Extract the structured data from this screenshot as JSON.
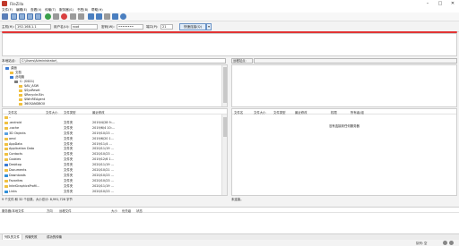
{
  "window": {
    "title": "FileZilla",
    "controls": [
      "–",
      "□",
      "✕"
    ]
  },
  "menu": [
    "文件(F)",
    "编辑(E)",
    "查看(V)",
    "传输(T)",
    "服务器(S)",
    "书签(B)",
    "帮助(H)"
  ],
  "toolbar": {
    "icons": [
      "site-manager-icon",
      "toggle-log-icon",
      "toggle-local-tree-icon",
      "toggle-remote-tree-icon",
      "toggle-queue-icon",
      "refresh-icon",
      "process-queue-icon",
      "cancel-icon",
      "disconnect-icon",
      "reconnect-icon",
      "filter-icon",
      "compare-icon",
      "sync-browse-icon",
      "search-icon",
      "binoculars-icon"
    ]
  },
  "quickconnect": {
    "host_label": "主机(H):",
    "host_value": "192.168.1.1",
    "user_label": "用户名(U):",
    "user_value": "root",
    "pass_label": "密码(W):",
    "pass_value": "••••••••",
    "port_label": "端口(P):",
    "port_value": "21",
    "connect_label": "快速连接(Q)",
    "dropdown_label": "▾"
  },
  "local": {
    "path_label": "本地站点:",
    "path_value": "C:\\Users\\Administrator\\",
    "tree": [
      {
        "label": "桌面",
        "level": 0,
        "color": "#3a7bd5"
      },
      {
        "label": "文档",
        "level": 1,
        "color": "#f0c040"
      },
      {
        "label": "此电脑",
        "level": 1,
        "color": "#3a7bd5"
      },
      {
        "label": "C: (SSD1)",
        "level": 2,
        "color": "#7a7a7a"
      },
      {
        "label": "$AV_ASW",
        "level": 3,
        "color": "#f0c040"
      },
      {
        "label": "$SysReset",
        "level": 3,
        "color": "#f0c040"
      },
      {
        "label": "$Recycle.Bin",
        "level": 3,
        "color": "#f0c040"
      },
      {
        "label": "$WinREAgent",
        "level": 3,
        "color": "#f0c040"
      },
      {
        "label": "360SANDBOX",
        "level": 3,
        "color": "#f0c040"
      }
    ],
    "headers": [
      "文件名",
      "文件大小",
      "文件类型",
      "最近修改"
    ],
    "files": [
      {
        "name": "..",
        "size": "",
        "type": "",
        "modified": "",
        "color": "#f0c040"
      },
      {
        "name": ".android",
        "size": "",
        "type": "文件夹",
        "modified": "2019/4/28 9:...",
        "color": "#f0c040"
      },
      {
        "name": ".cache",
        "size": "",
        "type": "文件夹",
        "modified": "2019/6/4 10:...",
        "color": "#f0c040"
      },
      {
        "name": "3D Objects",
        "size": "",
        "type": "文件夹",
        "modified": "2019/10/23 ...",
        "color": "#5aa0e0"
      },
      {
        "name": "amd",
        "size": "",
        "type": "文件夹",
        "modified": "2019/6/20 1...",
        "color": "#f0c040"
      },
      {
        "name": "AppData",
        "size": "",
        "type": "文件夹",
        "modified": "2019/11/4 ...",
        "color": "#f0c040"
      },
      {
        "name": "Application Data",
        "size": "",
        "type": "文件夹",
        "modified": "2020/11/19 ...",
        "color": "#f0c040"
      },
      {
        "name": "Contacts",
        "size": "",
        "type": "文件夹",
        "modified": "2020/10/23 ...",
        "color": "#f0c040"
      },
      {
        "name": "Cookies",
        "size": "",
        "type": "文件夹",
        "modified": "2019/12/6 1...",
        "color": "#f0c040"
      },
      {
        "name": "Desktop",
        "size": "",
        "type": "文件夹",
        "modified": "2020/11/19 ...",
        "color": "#3a7bd5"
      },
      {
        "name": "Documents",
        "size": "",
        "type": "文件夹",
        "modified": "2020/10/21 ...",
        "color": "#f0c040"
      },
      {
        "name": "Downloads",
        "size": "",
        "type": "文件夹",
        "modified": "2020/10/23 ...",
        "color": "#2f8fd8"
      },
      {
        "name": "Favorites",
        "size": "",
        "type": "文件夹",
        "modified": "2020/10/23 ...",
        "color": "#f0c040"
      },
      {
        "name": "IntelGraphicsProfil...",
        "size": "",
        "type": "文件夹",
        "modified": "2020/11/19 ...",
        "color": "#f0c040"
      },
      {
        "name": "Links",
        "size": "",
        "type": "文件夹",
        "modified": "2020/10/23 ...",
        "color": "#2f8fd8"
      }
    ],
    "status": "9 个文件 和 32 个目录。大小总计: 8,991,728 字节"
  },
  "remote": {
    "path_label": "远程站点:",
    "path_value": "",
    "headers": [
      "文件名",
      "文件大小",
      "文件类型",
      "最近修改",
      "权限",
      "所有者/组"
    ],
    "empty_msg": "没有连接到任何服务器",
    "status": "未连接。"
  },
  "queue": {
    "headers": [
      "服务器/本地文件",
      "方向",
      "远程文件",
      "大小",
      "优先级",
      "状态"
    ]
  },
  "tabs": [
    "列队的文件",
    "传输失败",
    "成功的传输"
  ],
  "bottom": {
    "queue_label": "队列: 空"
  }
}
